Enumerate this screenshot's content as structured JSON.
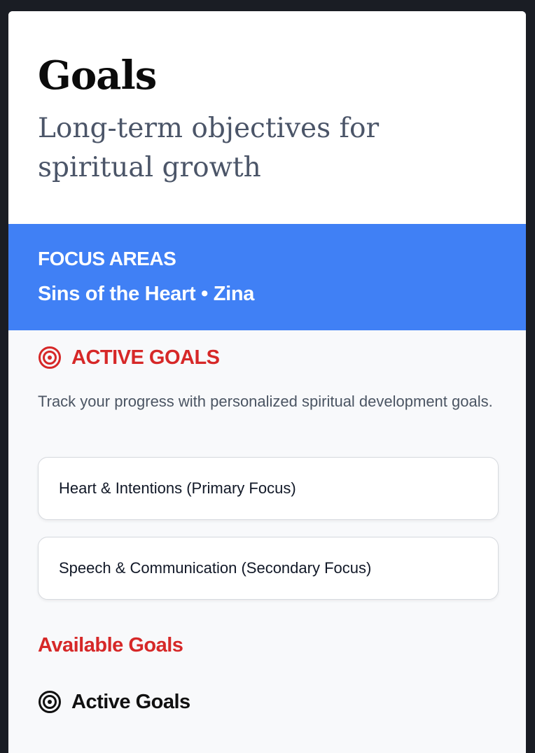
{
  "header": {
    "title": "Goals",
    "subtitle": "Long-term objectives for spiritual growth"
  },
  "focus": {
    "label": "FOCUS AREAS",
    "value": "Sins of the Heart • Zina",
    "background": "#4080f5"
  },
  "active_goals": {
    "icon": "target-icon",
    "title": "ACTIVE GOALS",
    "description": "Track your progress with personalized spiritual development goals.",
    "items": [
      {
        "label": "Heart & Intentions (Primary Focus)"
      },
      {
        "label": "Speech & Communication (Secondary Focus)"
      }
    ]
  },
  "available_goals": {
    "title": "Available Goals",
    "sub_section": {
      "icon": "target-icon",
      "title": "Active Goals"
    }
  },
  "colors": {
    "accent_red": "#d62828",
    "accent_blue": "#4080f5"
  }
}
